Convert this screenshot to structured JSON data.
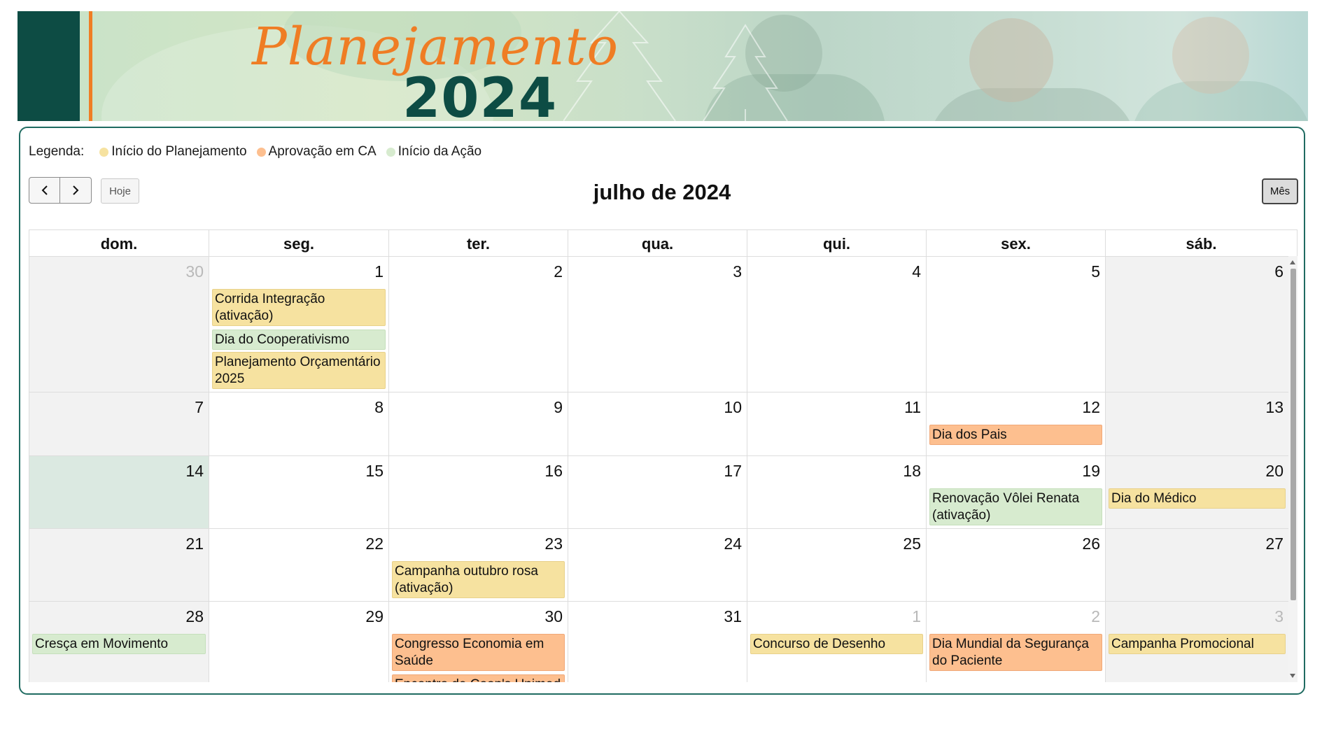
{
  "banner": {
    "script_title": "Planejamento",
    "year_title": "2024"
  },
  "legend": {
    "label": "Legenda:",
    "items": [
      {
        "label": "Início do Planejamento",
        "color": "#f6e2a0"
      },
      {
        "label": "Aprovação em CA",
        "color": "#fdbf8f"
      },
      {
        "label": "Início da Ação",
        "color": "#d7ebcf"
      }
    ]
  },
  "toolbar": {
    "prev_icon": "‹",
    "next_icon": "›",
    "today_label": "Hoje",
    "month_title": "julho de 2024",
    "view_label": "Mês"
  },
  "colors": {
    "yellow": "#f6e2a0",
    "green": "#d7ebcf",
    "orange": "#fdbf8f",
    "today": "#dbe9e1",
    "weekend": "#f2f2f2",
    "accent": "#1f6b61"
  },
  "weekdays": [
    "dom.",
    "seg.",
    "ter.",
    "qua.",
    "qui.",
    "sex.",
    "sáb."
  ],
  "weeks": [
    [
      {
        "n": "30",
        "other": true,
        "events": []
      },
      {
        "n": "1",
        "events": [
          {
            "t": "Corrida Integração (ativação)",
            "c": "yellow"
          },
          {
            "t": "Dia do Cooperativismo",
            "c": "green"
          },
          {
            "t": "Planejamento Orçamentário 2025",
            "c": "yellow"
          }
        ]
      },
      {
        "n": "2",
        "events": []
      },
      {
        "n": "3",
        "events": []
      },
      {
        "n": "4",
        "events": []
      },
      {
        "n": "5",
        "events": []
      },
      {
        "n": "6",
        "events": []
      }
    ],
    [
      {
        "n": "7",
        "events": []
      },
      {
        "n": "8",
        "events": []
      },
      {
        "n": "9",
        "events": []
      },
      {
        "n": "10",
        "events": []
      },
      {
        "n": "11",
        "events": []
      },
      {
        "n": "12",
        "events": [
          {
            "t": "Dia dos Pais",
            "c": "orange"
          }
        ]
      },
      {
        "n": "13",
        "events": []
      }
    ],
    [
      {
        "n": "14",
        "today": true,
        "events": []
      },
      {
        "n": "15",
        "events": []
      },
      {
        "n": "16",
        "events": []
      },
      {
        "n": "17",
        "events": []
      },
      {
        "n": "18",
        "events": []
      },
      {
        "n": "19",
        "events": [
          {
            "t": "Renovação Vôlei Renata (ativação)",
            "c": "green"
          }
        ]
      },
      {
        "n": "20",
        "events": [
          {
            "t": "Dia do Médico",
            "c": "yellow"
          }
        ]
      }
    ],
    [
      {
        "n": "21",
        "events": []
      },
      {
        "n": "22",
        "events": []
      },
      {
        "n": "23",
        "events": [
          {
            "t": "Campanha outubro rosa (ativação)",
            "c": "yellow"
          }
        ]
      },
      {
        "n": "24",
        "events": []
      },
      {
        "n": "25",
        "events": []
      },
      {
        "n": "26",
        "events": []
      },
      {
        "n": "27",
        "events": []
      }
    ],
    [
      {
        "n": "28",
        "events": [
          {
            "t": "Cresça em Movimento",
            "c": "green"
          }
        ]
      },
      {
        "n": "29",
        "events": []
      },
      {
        "n": "30",
        "events": [
          {
            "t": "Congresso Economia em Saúde",
            "c": "orange"
          },
          {
            "t": "Encontro de Coop's Unimed",
            "c": "orange"
          }
        ]
      },
      {
        "n": "31",
        "events": []
      },
      {
        "n": "1",
        "other": true,
        "events": [
          {
            "t": "Concurso de Desenho",
            "c": "yellow"
          }
        ]
      },
      {
        "n": "2",
        "other": true,
        "events": [
          {
            "t": "Dia Mundial da Segurança do Paciente",
            "c": "orange"
          }
        ]
      },
      {
        "n": "3",
        "other": true,
        "events": [
          {
            "t": "Campanha Promocional",
            "c": "yellow"
          }
        ]
      }
    ]
  ]
}
